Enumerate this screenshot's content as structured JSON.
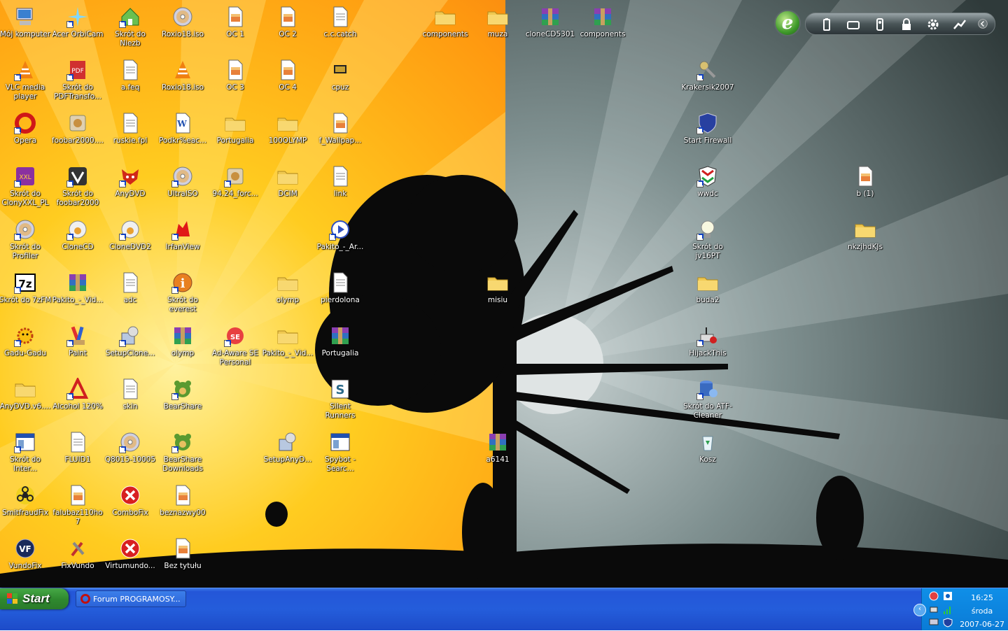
{
  "desktop": {
    "icons": [
      {
        "label": "Mój komputer",
        "kind": "computer"
      },
      {
        "label": "Acer OrbiCam",
        "kind": "star"
      },
      {
        "label": "Skrót do Niezb",
        "kind": "house"
      },
      {
        "label": "Roxio18.iso",
        "kind": "disc"
      },
      {
        "label": "OC 1",
        "kind": "image"
      },
      {
        "label": "OC 2",
        "kind": "image"
      },
      {
        "label": "c.c.catch",
        "kind": "doc"
      },
      {
        "label": "components",
        "kind": "folder"
      },
      {
        "label": "muza",
        "kind": "folder"
      },
      {
        "label": "cloneCD5301",
        "kind": "rar"
      },
      {
        "label": "components",
        "kind": "rar"
      },
      {
        "label": "VLC media player",
        "kind": "vlc"
      },
      {
        "label": "Skrót do PDFTransfo...",
        "kind": "pdf"
      },
      {
        "label": "a.feq",
        "kind": "cfg"
      },
      {
        "label": "Roxio18.iso",
        "kind": "vlc"
      },
      {
        "label": "OC 3",
        "kind": "image"
      },
      {
        "label": "OC 4",
        "kind": "image"
      },
      {
        "label": "cpuz",
        "kind": "chip"
      },
      {
        "label": "Krakersik2007",
        "kind": "keys"
      },
      {
        "label": "Opera",
        "kind": "opera"
      },
      {
        "label": "foobar2000....",
        "kind": "app"
      },
      {
        "label": "ruskie.fpl",
        "kind": "cfg"
      },
      {
        "label": "Podkr%eac...",
        "kind": "word"
      },
      {
        "label": "Portugalia",
        "kind": "folder"
      },
      {
        "label": "100OLYMP",
        "kind": "folder"
      },
      {
        "label": "f_Wallpap...",
        "kind": "image"
      },
      {
        "label": "Start Firewall",
        "kind": "shield"
      },
      {
        "label": "Skrót do ClonyXXL_PL",
        "kind": "clony"
      },
      {
        "label": "Skrót do foobar2000",
        "kind": "foobar"
      },
      {
        "label": "AnyDVD",
        "kind": "fox"
      },
      {
        "label": "UltraISO",
        "kind": "disc"
      },
      {
        "label": "94.24_forc...",
        "kind": "app"
      },
      {
        "label": "DCIM",
        "kind": "folder"
      },
      {
        "label": "link",
        "kind": "doc"
      },
      {
        "label": "wwdc",
        "kind": "wwdc"
      },
      {
        "label": "b (1)",
        "kind": "image"
      },
      {
        "label": "Skrót do Profiler",
        "kind": "disc"
      },
      {
        "label": "CloneCD",
        "kind": "sheep"
      },
      {
        "label": "CloneDVD2",
        "kind": "sheep"
      },
      {
        "label": "IrfanView",
        "kind": "irfan"
      },
      {
        "label": "Pakito_-_Ar...",
        "kind": "media"
      },
      {
        "label": "Skrót do jv16PT",
        "kind": "bulb"
      },
      {
        "label": "nkzjhdKJs",
        "kind": "folder"
      },
      {
        "label": "Skrót do 7zFM",
        "kind": "sevenz"
      },
      {
        "label": "Pakito_-_Vid...",
        "kind": "rar"
      },
      {
        "label": "adc",
        "kind": "doc"
      },
      {
        "label": "Skrót do everest",
        "kind": "info"
      },
      {
        "label": "olymp",
        "kind": "folder"
      },
      {
        "label": "pierdolona",
        "kind": "doc"
      },
      {
        "label": "misiu",
        "kind": "folder"
      },
      {
        "label": "buda2",
        "kind": "folder"
      },
      {
        "label": "Gadu-Gadu",
        "kind": "gg"
      },
      {
        "label": "Paint",
        "kind": "paint"
      },
      {
        "label": "SetupClone...",
        "kind": "setup"
      },
      {
        "label": "olymp",
        "kind": "rar"
      },
      {
        "label": "Ad-Aware SE Personal",
        "kind": "adaware"
      },
      {
        "label": "Pakito_-_Vid...",
        "kind": "folder"
      },
      {
        "label": "Portugalia",
        "kind": "rar"
      },
      {
        "label": "HijackThis",
        "kind": "hijack"
      },
      {
        "label": "AnyDVD.v6....",
        "kind": "folder"
      },
      {
        "label": "Alcohol 120%",
        "kind": "alcohol"
      },
      {
        "label": "skin",
        "kind": "cfg"
      },
      {
        "label": "BearShare",
        "kind": "bear"
      },
      {
        "label": "Silent Runners",
        "kind": "silent"
      },
      {
        "label": "Skrót do ATF-Cleaner",
        "kind": "atf"
      },
      {
        "label": "Skrót do Inter...",
        "kind": "window"
      },
      {
        "label": "FLUID1",
        "kind": "doc"
      },
      {
        "label": "Q8015-10005",
        "kind": "disc"
      },
      {
        "label": "BearShare Downloads",
        "kind": "bear"
      },
      {
        "label": "SetupAnyD...",
        "kind": "setup"
      },
      {
        "label": "Spybot - Searc...",
        "kind": "window"
      },
      {
        "label": "a6141",
        "kind": "rar"
      },
      {
        "label": "Kosz",
        "kind": "recycle"
      },
      {
        "label": "SmitfraudFix",
        "kind": "biohazard"
      },
      {
        "label": "falubaz110ho7",
        "kind": "image"
      },
      {
        "label": "ComboFix",
        "kind": "xred"
      },
      {
        "label": "beznazwy00",
        "kind": "image"
      },
      {
        "label": "VundoFix",
        "kind": "vf"
      },
      {
        "label": "FixVundo",
        "kind": "tools"
      },
      {
        "label": "Virtumundo...",
        "kind": "xred"
      },
      {
        "label": "Bez tytułu",
        "kind": "image"
      }
    ]
  },
  "taskbar": {
    "start_label": "Start",
    "tasks": [
      {
        "label": "Forum PROGRAMOSY...",
        "icon": "opera-icon"
      }
    ],
    "clock": {
      "time": "16:25",
      "day": "środa",
      "date": "2007-06-27"
    }
  },
  "colors": {
    "taskbar": "#245ddb",
    "start": "#2f8a2f",
    "tray": "#0f8fe8"
  }
}
